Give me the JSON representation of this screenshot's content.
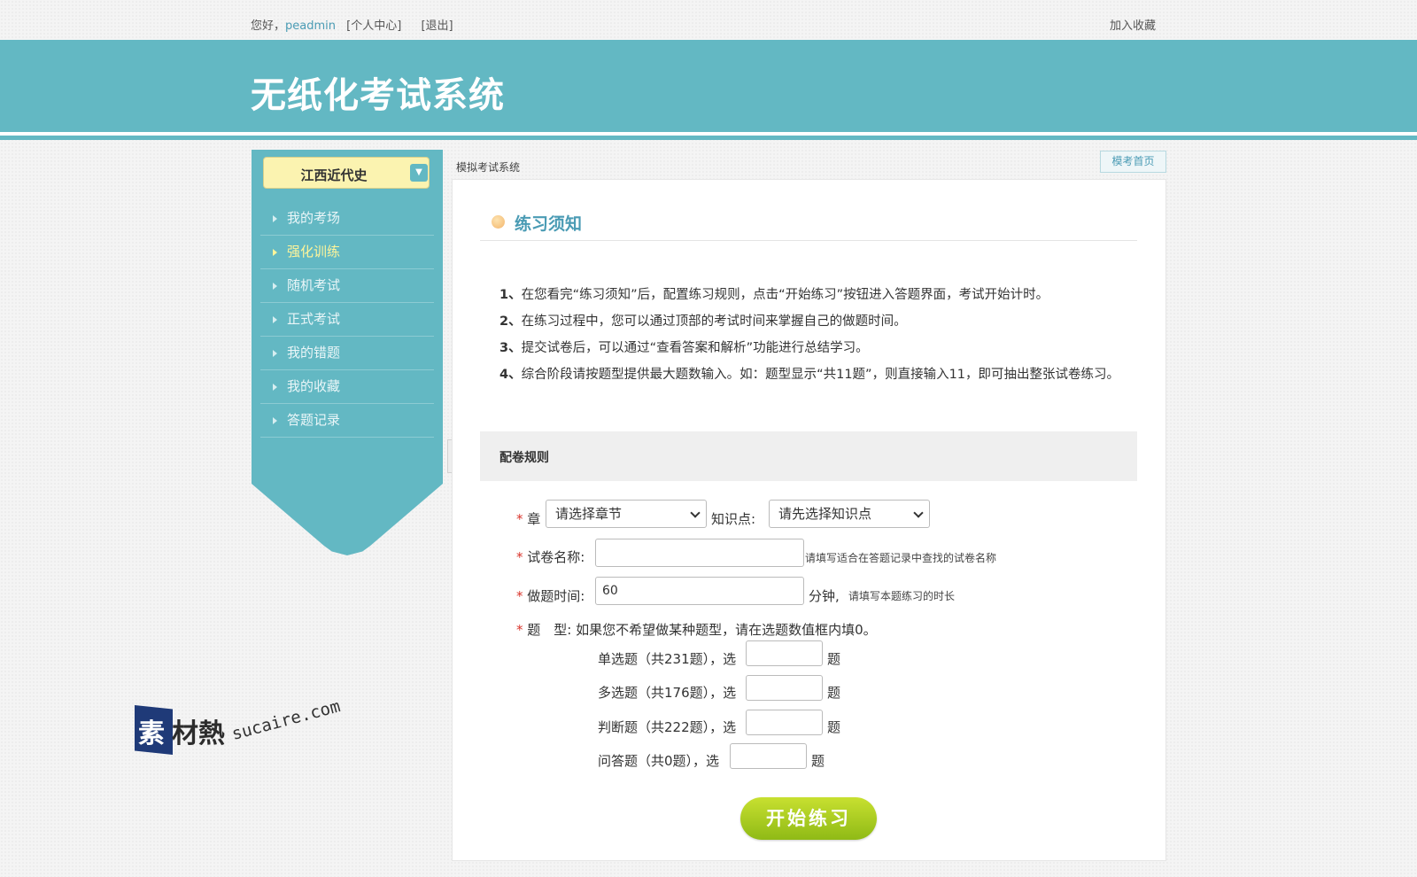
{
  "topbar": {
    "greeting": "您好，",
    "username": "peadmin",
    "personal_center": "[个人中心]",
    "logout": "[退出]",
    "bookmark": "加入收藏"
  },
  "header": {
    "title": "无纸化考试系统"
  },
  "sidebar": {
    "subject": "江西近代史",
    "items": [
      {
        "label": "我的考场"
      },
      {
        "label": "强化训练"
      },
      {
        "label": "随机考试"
      },
      {
        "label": "正式考试"
      },
      {
        "label": "我的错题"
      },
      {
        "label": "我的收藏"
      },
      {
        "label": "答题记录"
      }
    ],
    "active_index": 1
  },
  "breadcrumb": "模拟考试系统",
  "home_button": "模考首页",
  "notice": {
    "title": "练习须知",
    "rules": [
      {
        "num": "1、",
        "text": "在您看完“练习须知”后，配置练习规则，点击“开始练习”按钮进入答题界面，考试开始计时。"
      },
      {
        "num": "2、",
        "text": "在练习过程中，您可以通过顶部的考试时间来掌握自己的做题时间。"
      },
      {
        "num": "3、",
        "text": "提交试卷后，可以通过“查看答案和解析”功能进行总结学习。"
      },
      {
        "num": "4、",
        "text": "综合阶段请按题型提供最大题数输入。如：题型显示“共11题”，则直接输入11，即可抽出整张试卷练习。"
      }
    ]
  },
  "config": {
    "title": "配卷规则",
    "required_mark": "*",
    "chapter": {
      "label": "章",
      "value": "请选择章节"
    },
    "knowledge": {
      "label": "知识点:",
      "value": "请先选择知识点"
    },
    "paper_name": {
      "label": "试卷名称:",
      "value": "",
      "hint": "请填写适合在答题记录中查找的试卷名称"
    },
    "duration": {
      "label": "做题时间:",
      "value": "60",
      "unit": "分钟,",
      "hint": "请填写本题练习的时长"
    },
    "types": {
      "label": "题　型:",
      "hint": "如果您不希望做某种题型，请在选题数值框内填0。",
      "suffix": "题",
      "items": [
        {
          "label": "单选题（共231题），选",
          "value": ""
        },
        {
          "label": "多选题（共176题），选",
          "value": ""
        },
        {
          "label": "判断题（共222题），选",
          "value": ""
        },
        {
          "label": "问答题（共0题），选",
          "value": ""
        }
      ]
    }
  },
  "start_button": "开始练习",
  "watermark": {
    "char1": "素",
    "chars": "材熱",
    "url": "sucaire.com"
  },
  "colors": {
    "theme": "#63b8c3",
    "active_menu": "#fff59a",
    "required": "#d9342b",
    "start_button": "#a6cc1c"
  }
}
